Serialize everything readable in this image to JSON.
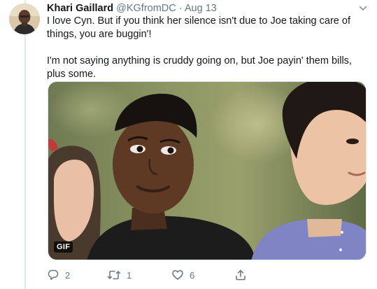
{
  "tweet": {
    "author_name": "Khari Gaillard",
    "handle": "@KGfromDC",
    "separator": "·",
    "date": "Aug 13",
    "text_paragraph_1": "I love Cyn.  But if  you think her silence isn't due to Joe taking care of things, you are buggin'!",
    "text_paragraph_2": "I'm not saying anything is cruddy going on, but Joe payin' them bills, plus some.",
    "media": {
      "badge": "GIF"
    },
    "actions": {
      "reply_count": "2",
      "retweet_count": "1",
      "like_count": "6"
    }
  },
  "icons": {
    "chevron": "chevron-down-icon",
    "reply": "reply-icon",
    "retweet": "retweet-icon",
    "like": "heart-icon",
    "share": "share-icon"
  },
  "colors": {
    "text_primary": "#14171a",
    "text_secondary": "#657786",
    "thread_line": "#e1e8ed"
  }
}
